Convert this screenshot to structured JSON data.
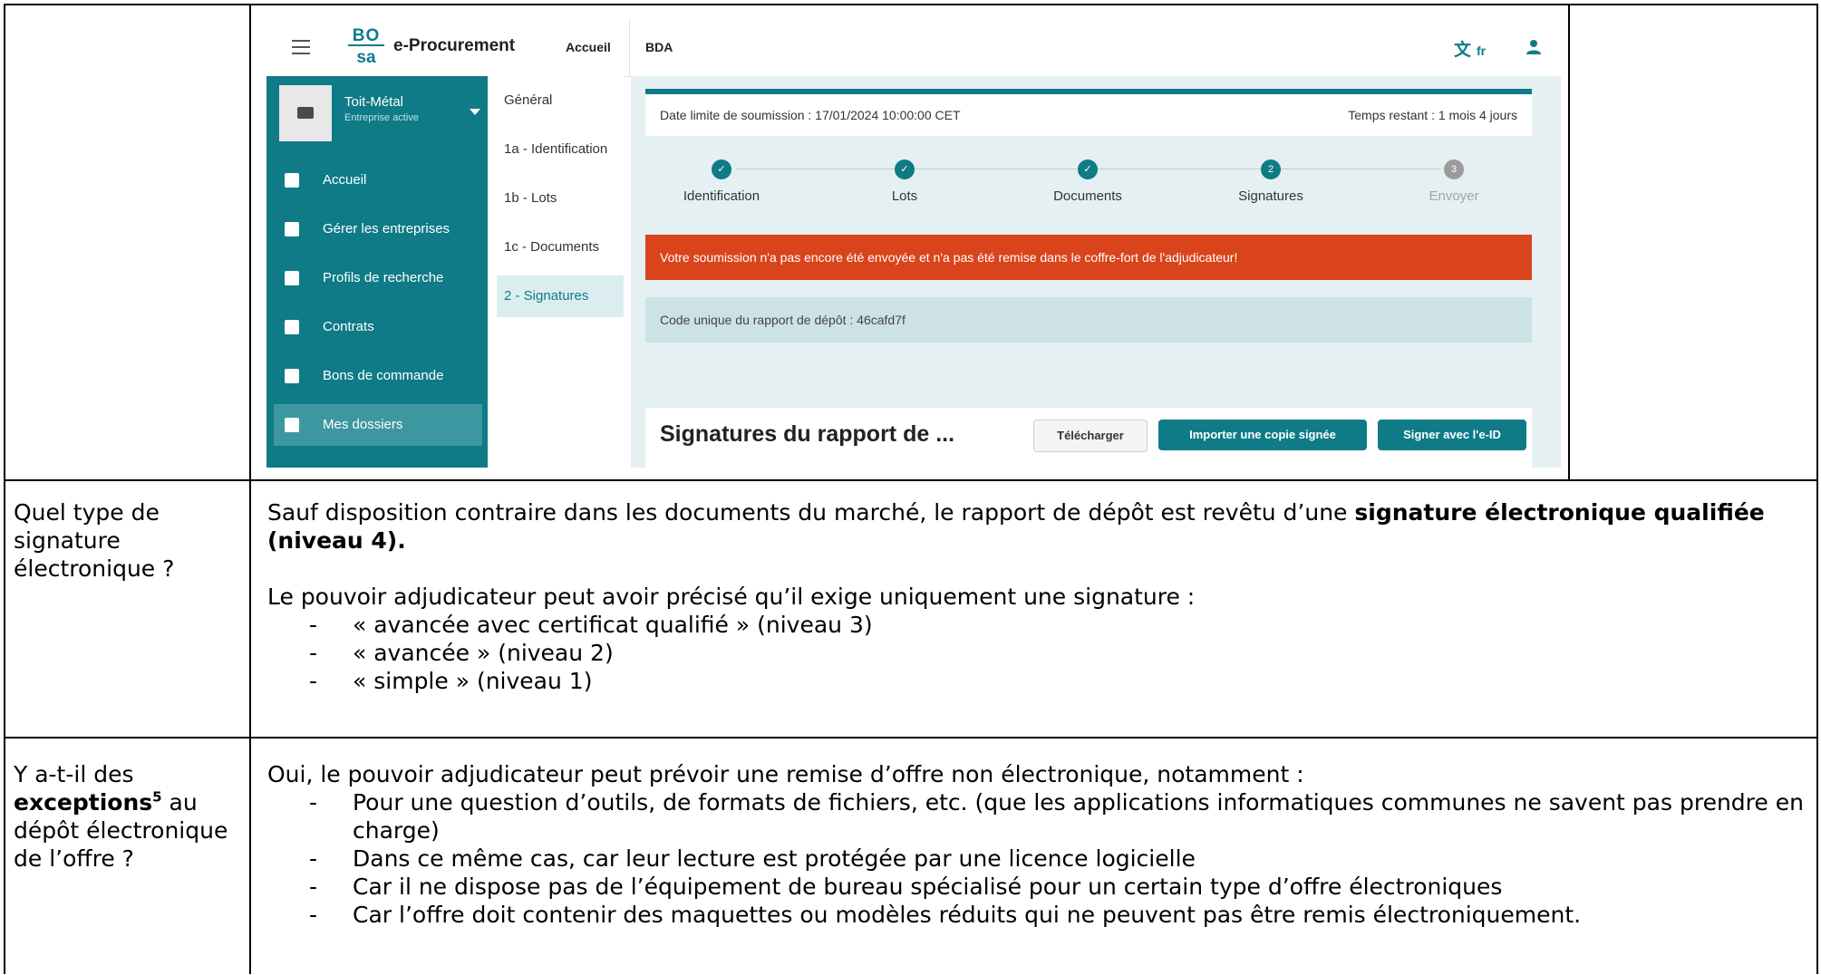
{
  "app": {
    "name": "e-Procurement",
    "logo_top": "BO",
    "logo_bottom": "sa",
    "nav_home": "Accueil",
    "nav_bda": "BDA",
    "lang": "fr",
    "company": {
      "name": "Toit-Métal",
      "status": "Entreprise active"
    },
    "sidebar": [
      {
        "label": "Accueil",
        "icon": "dashboard-icon"
      },
      {
        "label": "Gérer les entreprises",
        "icon": "bank-icon"
      },
      {
        "label": "Profils de recherche",
        "icon": "user-search-icon"
      },
      {
        "label": "Contrats",
        "icon": "document-icon"
      },
      {
        "label": "Bons de commande",
        "icon": "clipboard-icon"
      },
      {
        "label": "Mes dossiers",
        "icon": "bookmark-icon"
      }
    ],
    "subnav": [
      "Général",
      "1a - Identification",
      "1b - Lots",
      "1c - Documents",
      "2 - Signatures"
    ],
    "deadline": "Date limite de soumission : 17/01/2024 10:00:00 CET",
    "remaining": "Temps restant : 1 mois 4 jours",
    "steps": [
      {
        "label": "Identification",
        "mark": "✓",
        "state": "done"
      },
      {
        "label": "Lots",
        "mark": "✓",
        "state": "done"
      },
      {
        "label": "Documents",
        "mark": "✓",
        "state": "done"
      },
      {
        "label": "Signatures",
        "mark": "2",
        "state": "current"
      },
      {
        "label": "Envoyer",
        "mark": "3",
        "state": "todo"
      }
    ],
    "alert": "Votre soumission n'a pas encore été envoyée et n'a pas été remise dans le coffre-fort de l'adjudicateur!",
    "code": "Code unique du rapport de dépôt : 46cafd7f",
    "sig_title": "Signatures du rapport de ...",
    "btn_download": "Télécharger",
    "btn_import": "Importer une copie signée",
    "btn_sign": "Signer avec l'e-ID",
    "colors": {
      "primary": "#0e7b87",
      "alert": "#d9441c",
      "panel": "#e4f0f2"
    }
  },
  "rows": [
    {
      "question": "Quel type de signature électronique ?",
      "answer_intro": "Sauf disposition contraire dans les documents du marché, le rapport de dépôt est revêtu d’une ",
      "answer_bold": "signature électronique qualifiée (niveau 4).",
      "answer_p2": "Le pouvoir adjudicateur peut avoir précisé qu’il exige uniquement une signature :",
      "bullets": [
        "« avancée avec certificat qualifié » (niveau 3)",
        "« avancée » (niveau 2)",
        "« simple » (niveau 1)"
      ]
    },
    {
      "question_pre": "Y a-t-il des",
      "question_bold": "exceptions",
      "question_sup": "5",
      "question_post": " au dépôt électronique de l’offre ?",
      "answer_intro": "Oui, le pouvoir adjudicateur peut prévoir une remise d’offre non électronique, notamment :",
      "bullets": [
        "Pour une question d’outils, de formats de fichiers, etc. (que les applications informatiques communes ne savent pas prendre en charge)",
        "Dans ce même cas, car leur lecture est protégée par une licence logicielle",
        "Car il ne dispose pas de l’équipement de bureau spécialisé pour un certain type d’offre électroniques",
        "Car l’offre doit contenir des maquettes ou modèles réduits qui ne peuvent pas être remis électroniquement."
      ]
    }
  ]
}
